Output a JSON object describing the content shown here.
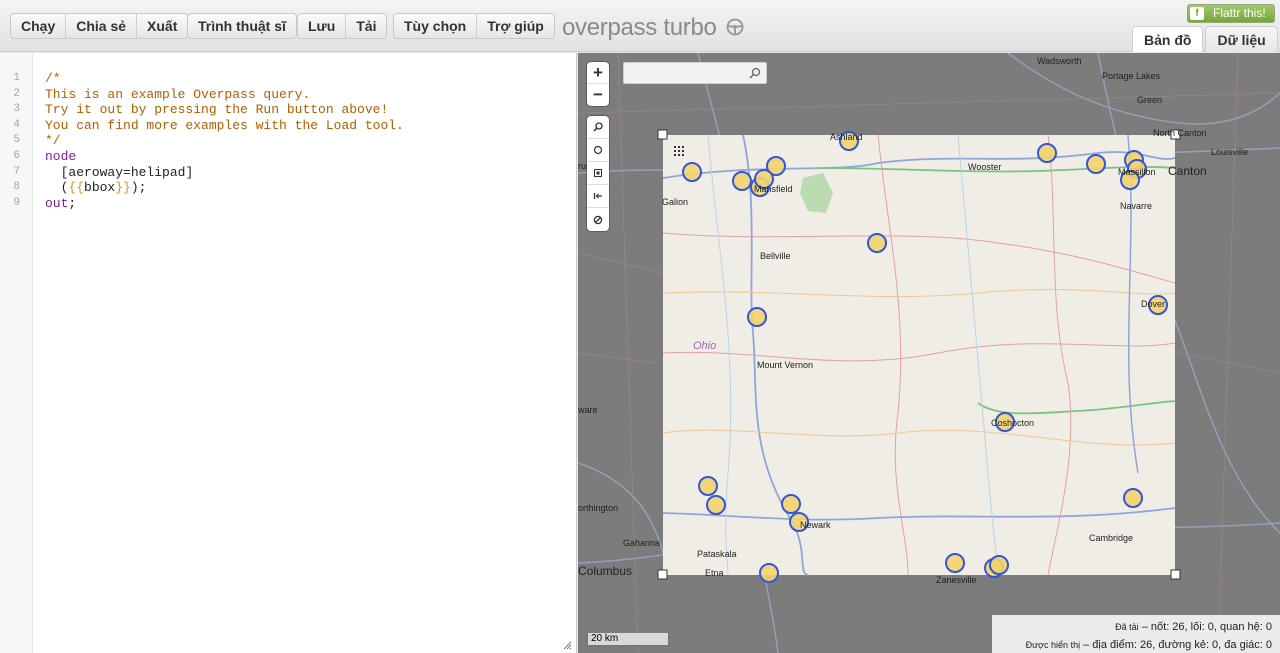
{
  "toolbar": {
    "run": "Chạy",
    "share": "Chia sẻ",
    "export": "Xuất",
    "wizard": "Trình thuật sĩ",
    "save": "Lưu",
    "load": "Tải",
    "settings": "Tùy chọn",
    "help": "Trợ giúp"
  },
  "brand": {
    "title": "overpass turbo"
  },
  "flattr": {
    "label": "Flattr this!"
  },
  "tabs": {
    "map": "Bản đồ",
    "data": "Dữ liệu"
  },
  "editor": {
    "line_numbers": [
      "1",
      "2",
      "3",
      "4",
      "5",
      "6",
      "7",
      "8",
      "9"
    ],
    "lines": [
      "/*",
      "This is an example Overpass query.",
      "Try it out by pressing the Run button above!",
      "You can find more examples with the Load tool.",
      "*/",
      "node",
      "  [aeroway=helipad]",
      "  ({{bbox}});",
      "out;"
    ],
    "tokens": {
      "kw_node": "node",
      "open_bracket": "[",
      "aeroway": "aeroway=helipad",
      "close_bracket": "]",
      "indent": "  ",
      "paren_open": "(",
      "brace_open": "{{",
      "bbox": "bbox",
      "brace_close": "}}",
      "paren_close_semi": ");",
      "kw_out": "out",
      "semi": ";"
    }
  },
  "map": {
    "labels": {
      "wadsworth": "Wadsworth",
      "portage_lakes": "Portage Lakes",
      "green": "Green",
      "ashland": "Ashland",
      "north_canton": "North Canton",
      "louisville": "Louisville",
      "canton": "Canton",
      "wooster": "Wooster",
      "massillon": "Massillon",
      "bucyrus": "rus",
      "mansfield": "Mansfield",
      "galion": "Galion",
      "navarre": "Navarre",
      "bellville": "Bellville",
      "dover": "Dover",
      "ohio": "Ohio",
      "mount_vernon": "Mount Vernon",
      "delaware": "ware",
      "coshocton": "Coshocton",
      "worthington": "orthington",
      "newark": "Newark",
      "cambridge": "Cambridge",
      "gahanna": "Gahanna",
      "pataskala": "Pataskala",
      "columbus": "Columbus",
      "etna": "Etna",
      "zanesville": "Zanesville"
    },
    "scale": "20 km"
  },
  "stats": {
    "loaded_label": "Đã tải",
    "loaded_values": " – nốt: 26, lối: 0, quan hệ: 0",
    "displayed_label": "Được hiển thị",
    "displayed_values": " – địa điểm: 26, đường kẻ: 0, đa giác: 0"
  },
  "colors": {
    "comment": "#b85c00",
    "keyword": "#7a1f9a",
    "marker_stroke": "#3355dd",
    "marker_fill": "#f2d36b",
    "bbox_fill": "#f4f1ea"
  }
}
